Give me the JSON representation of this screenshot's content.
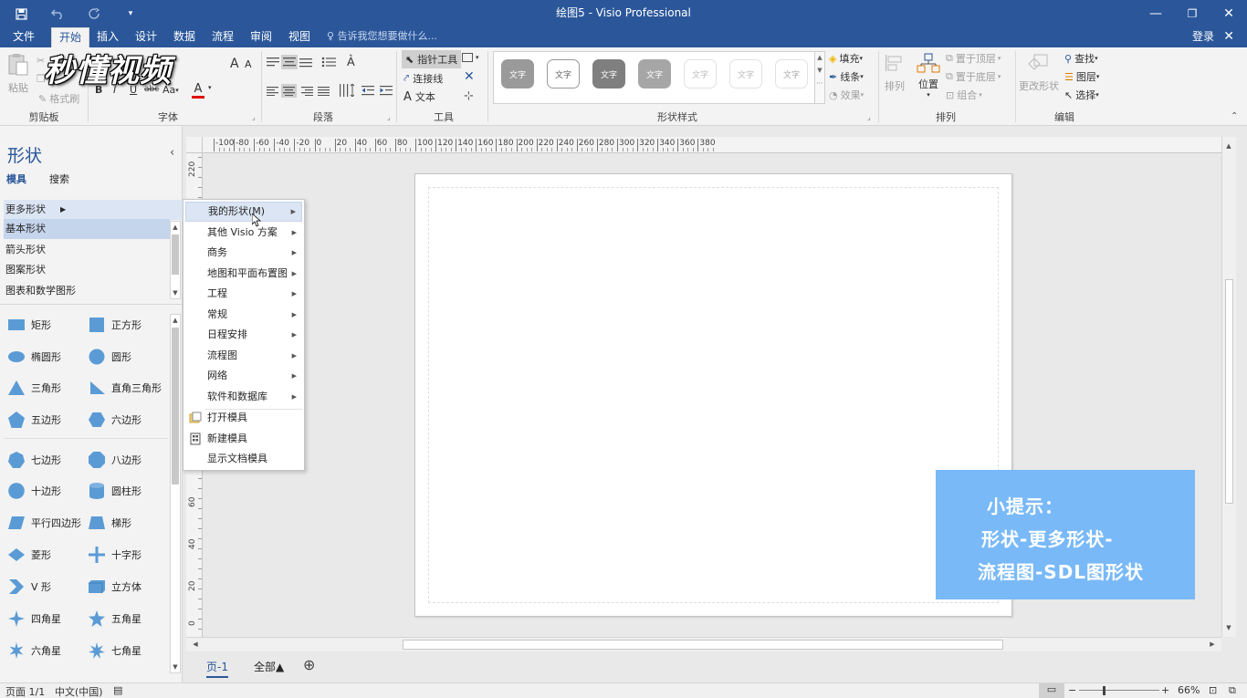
{
  "window": {
    "title": "绘图5 - Visio Professional",
    "minimize": "—",
    "restore": "❐",
    "close": "✕"
  },
  "menu": {
    "tabs": [
      "文件",
      "开始",
      "插入",
      "设计",
      "数据",
      "流程",
      "审阅",
      "视图"
    ],
    "active_tab": "开始",
    "tell_me": "告诉我您想要做什么...",
    "login": "登录",
    "close": "✕"
  },
  "ribbon": {
    "clipboard": {
      "label": "剪贴板",
      "paste": "粘贴",
      "format_painter": "格式刷"
    },
    "font": {
      "label": "字体",
      "bold": "B",
      "italic": "I",
      "underline": "U",
      "strike": "abc",
      "case": "Aa",
      "color": "A",
      "grow": "A",
      "shrink": "A"
    },
    "paragraph": {
      "label": "段落"
    },
    "tools": {
      "label": "工具",
      "pointer": "指针工具",
      "connector": "连接线",
      "text": "文本"
    },
    "shape_styles": {
      "label": "形状样式",
      "swatch_text": "文字",
      "fill": "填充",
      "line": "线条",
      "effect": "效果"
    },
    "arrange": {
      "label": "排列",
      "align": "排列",
      "position": "位置",
      "bring_front": "置于顶层",
      "send_back": "置于底层",
      "group": "组合"
    },
    "edit": {
      "label": "编辑",
      "change_shape": "更改形状",
      "find": "查找",
      "layers": "图层",
      "select": "选择"
    }
  },
  "shapes_panel": {
    "title": "形状",
    "tab_stencils": "模具",
    "tab_search": "搜索",
    "more_shapes": "更多形状",
    "stencils": [
      "基本形状",
      "箭头形状",
      "图案形状",
      "图表和数学图形"
    ],
    "shapes": [
      [
        "矩形",
        "正方形"
      ],
      [
        "椭圆形",
        "圆形"
      ],
      [
        "三角形",
        "直角三角形"
      ],
      [
        "五边形",
        "六边形"
      ],
      [
        "七边形",
        "八边形"
      ],
      [
        "十边形",
        "圆柱形"
      ],
      [
        "平行四边形",
        "梯形"
      ],
      [
        "菱形",
        "十字形"
      ],
      [
        "V 形",
        "立方体"
      ],
      [
        "四角星",
        "五角星"
      ],
      [
        "六角星",
        "七角星"
      ]
    ]
  },
  "context_menu": {
    "items": [
      "我的形状(M)",
      "其他 Visio 方案",
      "商务",
      "地图和平面布置图",
      "工程",
      "常规",
      "日程安排",
      "流程图",
      "网络",
      "软件和数据库"
    ],
    "actions": [
      "打开模具",
      "新建模具",
      "显示文档模具"
    ]
  },
  "rulers": {
    "h_ticks": [
      "-100",
      "-80",
      "-60",
      "-40",
      "-20",
      "0",
      "20",
      "40",
      "60",
      "80",
      "100",
      "120",
      "140",
      "160",
      "180",
      "200",
      "220",
      "240",
      "260",
      "280",
      "300",
      "320",
      "340",
      "360",
      "380"
    ],
    "v_ticks": [
      "220",
      "60",
      "40",
      "20",
      "0"
    ]
  },
  "page_tabs": {
    "page": "页-1",
    "all": "全部▲",
    "add": "⊕"
  },
  "hint": {
    "line1": "小提示：",
    "line2": "形状-更多形状-",
    "line3": "流程图-SDL图形状"
  },
  "watermark": "秒懂视频",
  "status": {
    "page": "页面 1/1",
    "language": "中文(中国)",
    "zoom": "66%",
    "zoom_minus": "−",
    "zoom_plus": "+"
  },
  "colors": {
    "accent": "#2b579a",
    "shape_blue": "#5b9bd5",
    "hint_bg": "#79b9f7"
  }
}
